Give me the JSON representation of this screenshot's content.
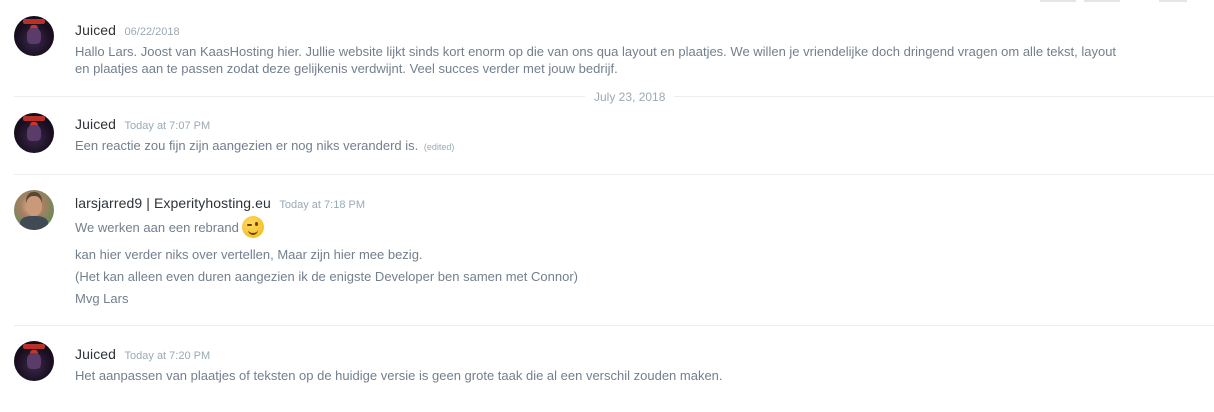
{
  "date_divider": "July 23, 2018",
  "messages": [
    {
      "username": "Juiced",
      "avatar": "juiced-avatar",
      "timestamp": "06/22/2018",
      "lines": [
        "Hallo Lars. Joost van KaasHosting hier. Jullie website lijkt sinds kort enorm op die van ons qua layout en plaatjes. We willen je vriendelijke doch dringend vragen om alle tekst, layout",
        "en plaatjes aan te passen zodat deze gelijkenis verdwijnt. Veel succes verder met jouw bedrijf."
      ]
    },
    {
      "username": "Juiced",
      "avatar": "juiced-avatar",
      "timestamp": "Today at 7:07 PM",
      "lines": [
        "Een reactie zou fijn zijn aangezien er nog niks veranderd is."
      ],
      "edited": "(edited)"
    },
    {
      "username": "larsjarred9 | Experityhosting.eu",
      "avatar": "lars-avatar",
      "timestamp": "Today at 7:18 PM",
      "lines": [
        "We werken aan een rebrand",
        "kan hier verder niks over vertellen, Maar zijn hier mee bezig.",
        "(Het kan alleen even duren aangezien ik de enigste Developer ben samen met Connor)",
        "Mvg Lars"
      ],
      "emoji": "winking-face-emoji"
    },
    {
      "username": "Juiced",
      "avatar": "juiced-avatar",
      "timestamp": "Today at 7:20 PM",
      "lines": [
        "Het aanpassen van plaatjes of teksten op de huidige versie is geen grote taak die al een verschil zouden maken."
      ]
    }
  ],
  "colors": {
    "username": "#2e3338",
    "message_text": "#737f8d",
    "timestamp": "#99aab5",
    "divider": "#eceeef",
    "emoji": "#f7c12b"
  }
}
